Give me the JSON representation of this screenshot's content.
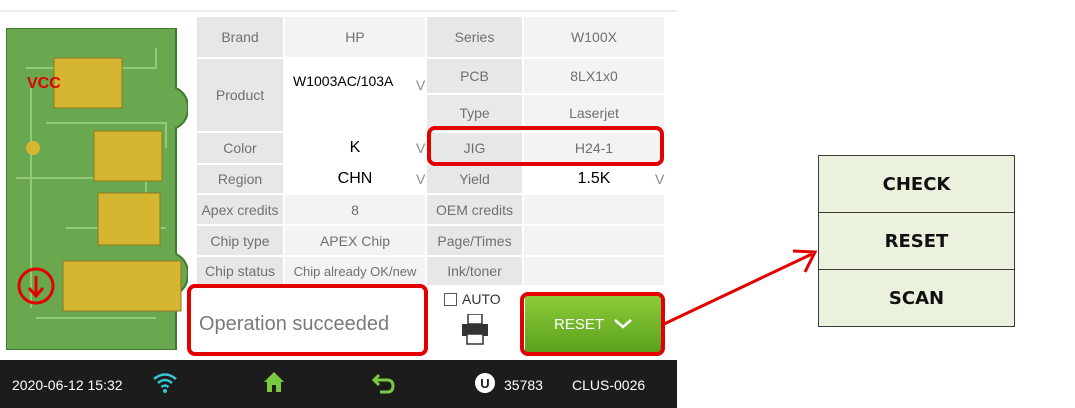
{
  "colors": {
    "accent_green": "#6cb52a",
    "highlight_red": "#e30000",
    "pcb_green": "#6aa84f",
    "chip_yellow": "#d6b631"
  },
  "pcb": {
    "vcc_label": "VCC"
  },
  "table": {
    "brand_label": "Brand",
    "brand_value": "HP",
    "series_label": "Series",
    "series_value": "W100X",
    "product_label": "Product",
    "product_value": "W1003AC/103A",
    "pcb_label": "PCB",
    "pcb_value": "8LX1x0",
    "type_label": "Type",
    "type_value": "Laserjet",
    "color_label": "Color",
    "color_value": "K",
    "jig_label": "JIG",
    "jig_value": "H24-1",
    "region_label": "Region",
    "region_value": "CHN",
    "yield_label": "Yield",
    "yield_value": "1.5K",
    "apex_credits_label": "Apex credits",
    "apex_credits_value": "8",
    "oem_credits_label": "OEM credits",
    "oem_credits_value": "",
    "chip_type_label": "Chip type",
    "chip_type_value": "APEX Chip",
    "page_times_label": "Page/Times",
    "page_times_value": "",
    "chip_status_label": "Chip status",
    "chip_status_value": "Chip already OK/new",
    "ink_toner_label": "Ink/toner",
    "ink_toner_value": "",
    "dropdown_mark": "V"
  },
  "operation": {
    "message": "Operation succeeded"
  },
  "auto": {
    "label": "AUTO",
    "checked": false
  },
  "action": {
    "selected": "RESET"
  },
  "status_bar": {
    "datetime": "2020-06-12 15:32",
    "u_badge": "U",
    "count": "35783",
    "device_id": "CLUS-0026"
  },
  "menu": {
    "items": [
      "CHECK",
      "RESET",
      "SCAN"
    ]
  }
}
